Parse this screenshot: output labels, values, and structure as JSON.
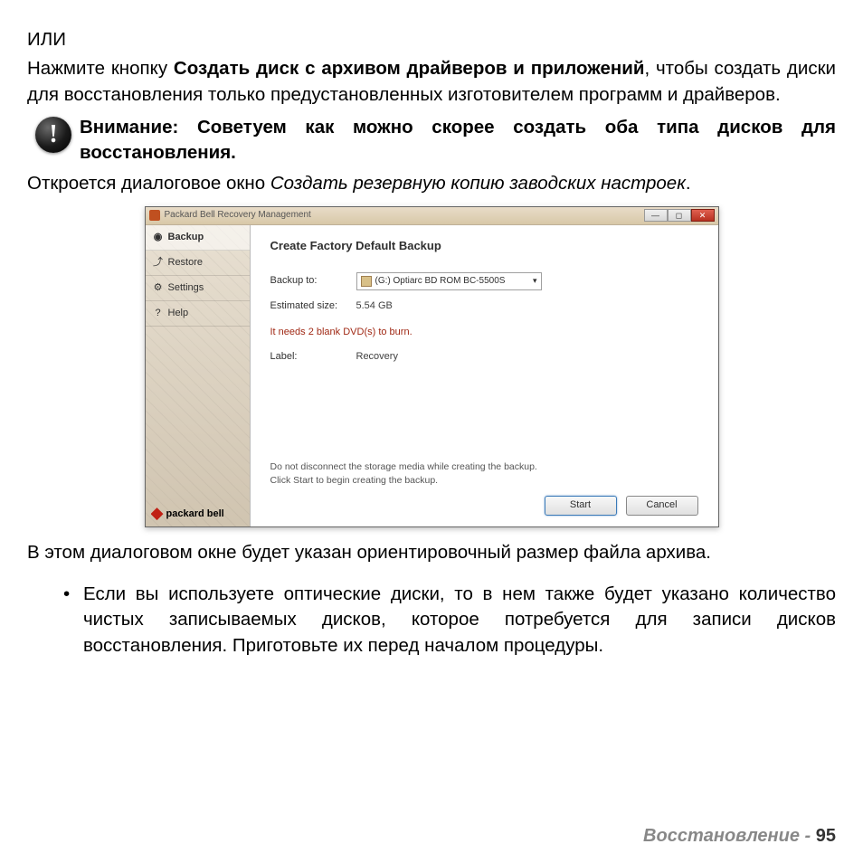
{
  "doc": {
    "or_text": "ИЛИ",
    "p1_a": "Нажмите кнопку ",
    "p1_bold": "Создать диск с архивом драйверов и приложений",
    "p1_b": ", чтобы создать диски для восстановления только предустановленных изготовителем программ и драйверов.",
    "warning": "Внимание: Советуем как можно скорее создать оба типа дисков для восстановления.",
    "p2_a": "Откроется диалоговое окно ",
    "p2_italic": "Создать резервную копию заводских настроек",
    "p2_b": ".",
    "p3": "В этом диалоговом окне будет указан ориентировочный размер файла архива.",
    "bullet1": "Если вы используете оптические диски, то в нем также будет указано количество чистых записываемых дисков, которое потребуется для записи дисков восстановления. Приготовьте их перед началом процедуры."
  },
  "dialog": {
    "title": "Packard Bell Recovery Management",
    "sidebar": {
      "backup": "Backup",
      "restore": "Restore",
      "settings": "Settings",
      "help": "Help"
    },
    "brand": "packard bell",
    "panel_title": "Create Factory Default Backup",
    "backup_to_label": "Backup to:",
    "backup_to_value": "(G:) Optiarc  BD ROM BC-5500S",
    "est_label": "Estimated size:",
    "est_value": "5.54 GB",
    "needs_note": "It needs 2 blank DVD(s) to burn.",
    "label_label": "Label:",
    "label_value": "Recovery",
    "note1": "Do not disconnect the storage media while creating the backup.",
    "note2": "Click Start to begin creating the backup.",
    "start": "Start",
    "cancel": "Cancel"
  },
  "footer": {
    "section": "Восстановление -",
    "page": "95"
  }
}
